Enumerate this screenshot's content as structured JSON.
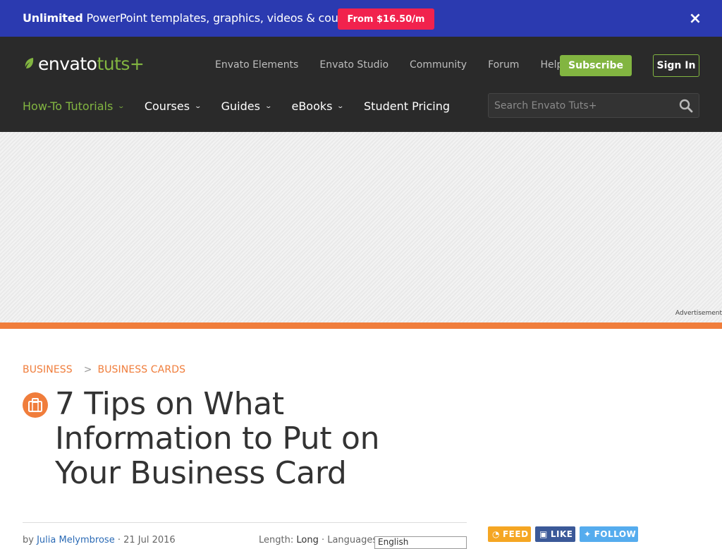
{
  "promo": {
    "bold": "Unlimited",
    "text": " PowerPoint templates, graphics, videos & courses!",
    "button": "From $16.50/m",
    "close": "×"
  },
  "logo": {
    "envato": "envato",
    "tuts": "tuts+"
  },
  "top_links": [
    "Envato Elements",
    "Envato Studio",
    "Community",
    "Forum",
    "Help"
  ],
  "subscribe": "Subscribe",
  "signin": "Sign In",
  "nav": [
    {
      "label": "How-To Tutorials",
      "dropdown": true,
      "active": true
    },
    {
      "label": "Courses",
      "dropdown": true
    },
    {
      "label": "Guides",
      "dropdown": true
    },
    {
      "label": "eBooks",
      "dropdown": true
    },
    {
      "label": "Student Pricing",
      "dropdown": false
    }
  ],
  "search": {
    "placeholder": "Search Envato Tuts+"
  },
  "ad": {
    "label": "Advertisement"
  },
  "breadcrumb": {
    "first": "BUSINESS",
    "sep": ">",
    "second": "BUSINESS CARDS"
  },
  "article": {
    "title": "7 Tips on What Information to Put on Your Business Card",
    "by": "by ",
    "author": "Julia Melymbrose",
    "date": " · 21 Jul 2016",
    "length_label": "Length: ",
    "length_value": "Long",
    "languages_label": " · Languages:",
    "language_selected": "English"
  },
  "social": {
    "feed": "FEED",
    "like": "LIKE",
    "follow": "FOLLOW"
  },
  "colors": {
    "promo_bg": "#2b3ab0",
    "accent_green": "#82b541",
    "accent_orange": "#f07d3b",
    "promo_button": "#f1224d"
  }
}
